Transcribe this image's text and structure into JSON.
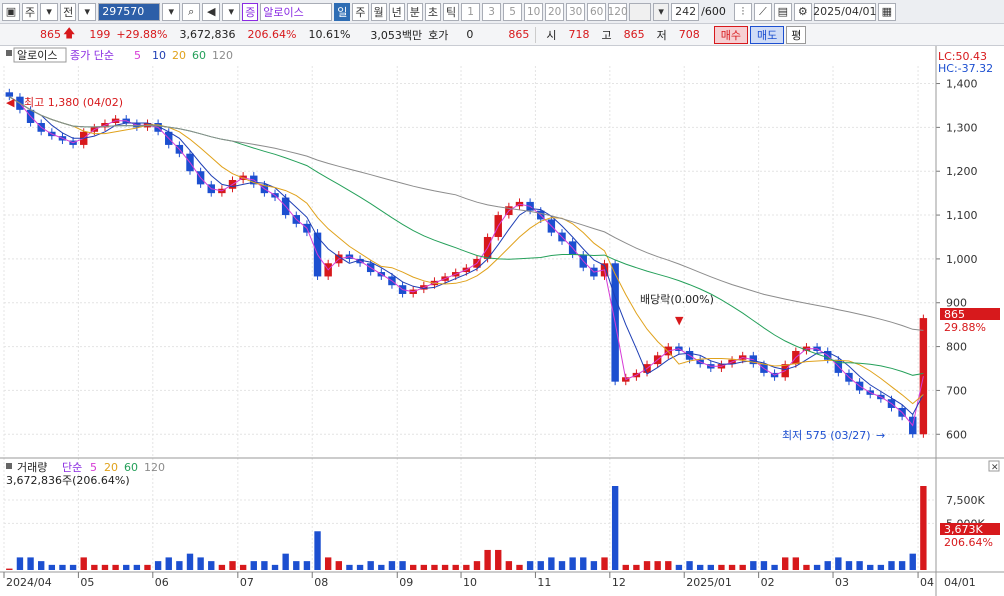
{
  "toolbar": {
    "period_code": "주",
    "mode": "전",
    "stock_code": "297570",
    "stock_badge": "증",
    "stock_name": "알로이스",
    "timeframes": [
      "일",
      "주",
      "월",
      "년",
      "분",
      "초",
      "틱"
    ],
    "selected_timeframe": "일",
    "periods": [
      "1",
      "3",
      "5",
      "10",
      "20",
      "30",
      "60",
      "120"
    ],
    "count": "242",
    "count_total": "/600",
    "date": "2025/04/01"
  },
  "quote": {
    "price": "865",
    "change": "199",
    "change_pct": "+29.88%",
    "volume": "3,672,836",
    "volume_ratio": "206.64%",
    "turnover": "10.61%",
    "amount": "3,053백만",
    "bid_label": "호가",
    "bid_value": "0",
    "ask_value": "865",
    "open_label": "시",
    "open_value": "718",
    "high_label": "고",
    "high_value": "865",
    "low_label": "저",
    "low_value": "708",
    "buy_label": "매수",
    "sell_label": "매도",
    "avg_label": "평"
  },
  "price_panel": {
    "title": "알로이스",
    "ma_label": "종가 단순",
    "ma_periods": [
      "5",
      "10",
      "20",
      "60",
      "120"
    ],
    "lc": "LC:50.43",
    "hc": "HC:-37.32",
    "high_annotation": "최고 1,380 (04/02)",
    "low_annotation": "최저 575 (03/27)",
    "dividend_annotation": "배당락(0.00%)",
    "current_price_tag": "865",
    "current_pct_tag": "29.88%"
  },
  "volume_panel": {
    "title": "거래량",
    "ma_label": "단순",
    "ma_periods": [
      "5",
      "20",
      "60",
      "120"
    ],
    "value_line": "3,672,836주(206.64%)",
    "current_tag": "3,673K",
    "current_pct_tag": "206.64%"
  },
  "colors": {
    "up": "#d7191c",
    "down": "#1c4fd0",
    "ma5": "#d63bd6",
    "ma10": "#1f3fb5",
    "ma20": "#e0a21c",
    "ma60": "#25a05a",
    "ma120": "#8c8c8c"
  },
  "chart_data": {
    "type": "candlestick",
    "y_axis_ticks": [
      "1,400",
      "1,300",
      "1,200",
      "1,100",
      "1,000",
      "900",
      "800",
      "700",
      "600"
    ],
    "ylim": [
      555,
      1440
    ],
    "x_axis_ticks": [
      "2024/04",
      "05",
      "06",
      "07",
      "08",
      "09",
      "10",
      "11",
      "12",
      "2025/01",
      "02",
      "03",
      "04",
      "04/01"
    ],
    "volume_axis_ticks": [
      "7,500K",
      "5,000K"
    ],
    "volume_ylim": [
      0,
      9000
    ],
    "price_series": [
      {
        "month": "2024/04",
        "close": [
          1370,
          1340,
          1310,
          1290,
          1280,
          1270,
          1260
        ]
      },
      {
        "month": "05",
        "close": [
          1290,
          1300,
          1310,
          1320,
          1310,
          1300,
          1310
        ]
      },
      {
        "month": "06",
        "close": [
          1290,
          1260,
          1240,
          1200,
          1170,
          1150,
          1160,
          1180
        ]
      },
      {
        "month": "07",
        "close": [
          1190,
          1170,
          1150,
          1140,
          1100,
          1080,
          1060
        ]
      },
      {
        "month": "08",
        "close": [
          960,
          990,
          1010,
          1000,
          990,
          970,
          960,
          940
        ]
      },
      {
        "month": "09",
        "close": [
          920,
          930,
          940,
          950,
          960,
          970
        ]
      },
      {
        "month": "10",
        "close": [
          980,
          1000,
          1050,
          1100,
          1120,
          1130,
          1110
        ]
      },
      {
        "month": "11",
        "close": [
          1090,
          1060,
          1040,
          1010,
          980,
          960,
          990
        ]
      },
      {
        "month": "12",
        "close": [
          720,
          730,
          740,
          760,
          780,
          800,
          790
        ]
      },
      {
        "month": "2025/01",
        "close": [
          770,
          760,
          750,
          760,
          770,
          780,
          760
        ]
      },
      {
        "month": "02",
        "close": [
          740,
          730,
          760,
          790,
          800,
          790,
          770
        ]
      },
      {
        "month": "03",
        "close": [
          740,
          720,
          700,
          690,
          680,
          660,
          640,
          600
        ]
      },
      {
        "month": "04",
        "close": [
          865
        ]
      }
    ]
  }
}
